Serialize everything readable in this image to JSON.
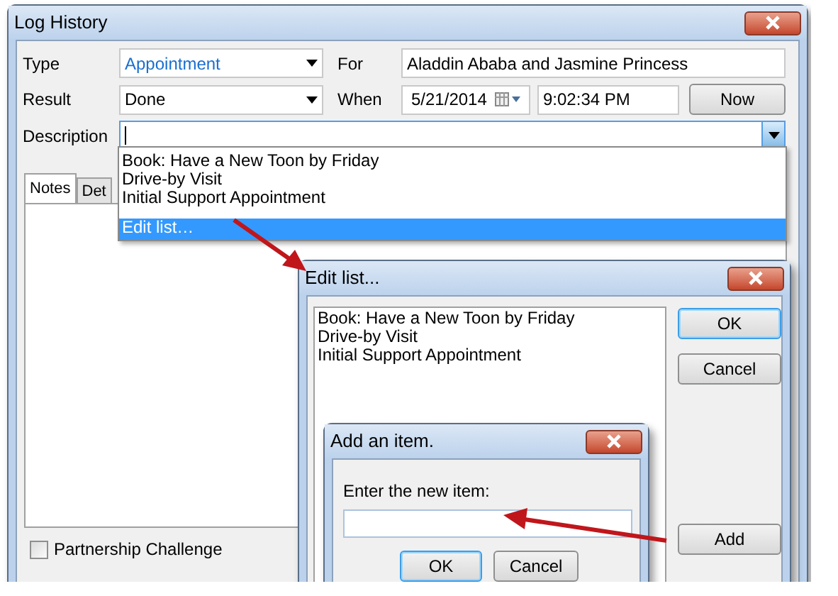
{
  "main_window": {
    "title": "Log History",
    "type": {
      "label": "Type",
      "value": "Appointment"
    },
    "for": {
      "label": "For",
      "value": "Aladdin Ababa and Jasmine Princess"
    },
    "result": {
      "label": "Result",
      "value": "Done"
    },
    "when": {
      "label": "When",
      "date": "5/21/2014",
      "time": "9:02:34 PM"
    },
    "now_button": "Now",
    "description": {
      "label": "Description"
    },
    "dropdown_items": [
      {
        "label": "Book: Have a New Toon by Friday",
        "selected": false
      },
      {
        "label": "Drive-by Visit",
        "selected": false
      },
      {
        "label": "Initial Support Appointment",
        "selected": false
      },
      {
        "label": "Edit list…",
        "selected": true
      }
    ],
    "tabs": [
      {
        "label": "Notes",
        "selected": true
      },
      {
        "label": "Det",
        "selected": false
      }
    ],
    "checkbox": {
      "label": "Partnership Challenge",
      "checked": false
    }
  },
  "edit_dialog": {
    "title": "Edit list...",
    "items": [
      "Book: Have a New Toon by Friday",
      "Drive-by Visit",
      "Initial Support Appointment"
    ],
    "buttons": [
      {
        "label": "OK",
        "focused": true
      },
      {
        "label": "Cancel",
        "focused": false
      }
    ],
    "add_button": "Add"
  },
  "add_dialog": {
    "title": "Add an item.",
    "prompt": "Enter the new item:",
    "buttons": [
      {
        "label": "OK",
        "focused": true
      },
      {
        "label": "Cancel",
        "focused": false
      }
    ]
  }
}
